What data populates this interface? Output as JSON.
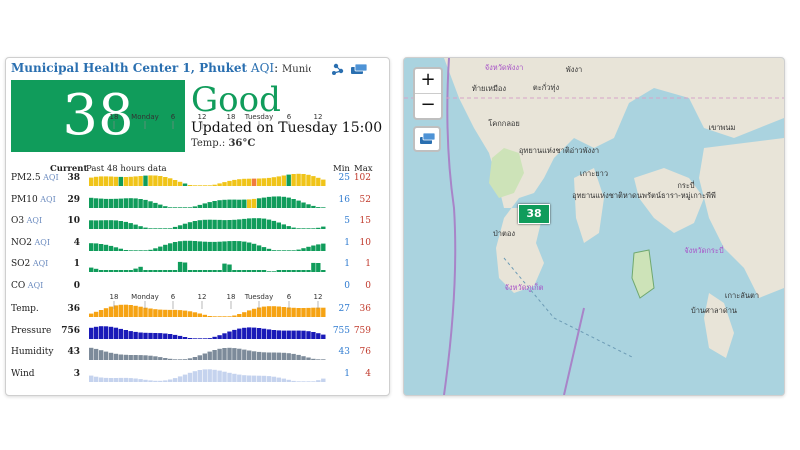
{
  "header": {
    "station": "Municipal Health Center 1, Phuket",
    "aqi_word": "AQI",
    "colon": ":",
    "rest": "Municipal Heal"
  },
  "main": {
    "aqi_value": "38",
    "status": "Good",
    "updated": "Updated on Tuesday 15:00",
    "temp_label": "Temp.:",
    "temp_value": "36°C"
  },
  "table": {
    "current_label": "Current",
    "history_label": "Past 48 hours data",
    "min_label": "Min",
    "max_label": "Max",
    "time_ticks": [
      "18",
      "Monday",
      "6",
      "12",
      "18",
      "Tuesday",
      "6",
      "12"
    ],
    "aqi_suffix": "AQI",
    "rows": [
      {
        "name": "PM2.5",
        "aqi": true,
        "current": "38",
        "min": "25",
        "max": "102",
        "color": "#f0c419"
      },
      {
        "name": "PM10",
        "aqi": true,
        "current": "29",
        "min": "16",
        "max": "52",
        "color": "#109c5b"
      },
      {
        "name": "O3",
        "aqi": true,
        "current": "10",
        "min": "5",
        "max": "15",
        "color": "#109c5b"
      },
      {
        "name": "NO2",
        "aqi": true,
        "current": "4",
        "min": "1",
        "max": "10",
        "color": "#109c5b"
      },
      {
        "name": "SO2",
        "aqi": true,
        "current": "1",
        "min": "1",
        "max": "1",
        "color": "#109c5b"
      },
      {
        "name": "CO",
        "aqi": true,
        "current": "0",
        "min": "0",
        "max": "0",
        "color": "#109c5b"
      },
      {
        "name": "Temp.",
        "aqi": false,
        "current": "36",
        "min": "27",
        "max": "36",
        "color": "#f6a313"
      },
      {
        "name": "Pressure",
        "aqi": false,
        "current": "756",
        "min": "755",
        "max": "759",
        "color": "#1a1ab8"
      },
      {
        "name": "Humidity",
        "aqi": false,
        "current": "43",
        "min": "43",
        "max": "76",
        "color": "#7d8b9a"
      },
      {
        "name": "Wind",
        "aqi": false,
        "current": "3",
        "min": "1",
        "max": "4",
        "color": "#c5d3ee"
      }
    ]
  },
  "map": {
    "zoom_in": "+",
    "zoom_out": "−",
    "marker_value": "38",
    "place_labels": [
      "จังหวัดพังงา",
      "พังงา",
      "ท้ายเหมือง",
      "ตะกั่วทุ่ง",
      "โคกกลอย",
      "อุทยานแห่งชาติอ่าวพังงา",
      "เกาะยาว",
      "ภูเก็ต",
      "ป่าตอง",
      "จังหวัดภูเก็ต",
      "อุทยานแห่งชาติหาดนพรัตน์ธารา-หมู่เกาะพีพี",
      "กระบี่",
      "เกาะลันตา",
      "บ้านศาลาด่าน",
      "จังหวัดกระบี่",
      "เขาพนม"
    ]
  }
}
